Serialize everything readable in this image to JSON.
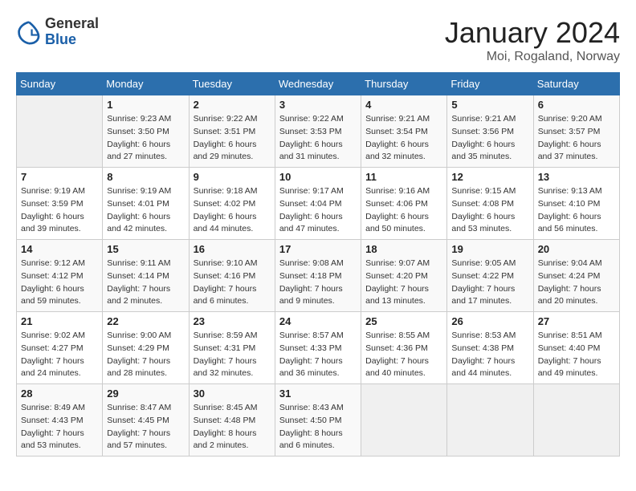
{
  "header": {
    "logo_line1": "General",
    "logo_line2": "Blue",
    "title": "January 2024",
    "subtitle": "Moi, Rogaland, Norway"
  },
  "days_of_week": [
    "Sunday",
    "Monday",
    "Tuesday",
    "Wednesday",
    "Thursday",
    "Friday",
    "Saturday"
  ],
  "weeks": [
    [
      {
        "day": "",
        "info": ""
      },
      {
        "day": "1",
        "info": "Sunrise: 9:23 AM\nSunset: 3:50 PM\nDaylight: 6 hours\nand 27 minutes."
      },
      {
        "day": "2",
        "info": "Sunrise: 9:22 AM\nSunset: 3:51 PM\nDaylight: 6 hours\nand 29 minutes."
      },
      {
        "day": "3",
        "info": "Sunrise: 9:22 AM\nSunset: 3:53 PM\nDaylight: 6 hours\nand 31 minutes."
      },
      {
        "day": "4",
        "info": "Sunrise: 9:21 AM\nSunset: 3:54 PM\nDaylight: 6 hours\nand 32 minutes."
      },
      {
        "day": "5",
        "info": "Sunrise: 9:21 AM\nSunset: 3:56 PM\nDaylight: 6 hours\nand 35 minutes."
      },
      {
        "day": "6",
        "info": "Sunrise: 9:20 AM\nSunset: 3:57 PM\nDaylight: 6 hours\nand 37 minutes."
      }
    ],
    [
      {
        "day": "7",
        "info": "Sunrise: 9:19 AM\nSunset: 3:59 PM\nDaylight: 6 hours\nand 39 minutes."
      },
      {
        "day": "8",
        "info": "Sunrise: 9:19 AM\nSunset: 4:01 PM\nDaylight: 6 hours\nand 42 minutes."
      },
      {
        "day": "9",
        "info": "Sunrise: 9:18 AM\nSunset: 4:02 PM\nDaylight: 6 hours\nand 44 minutes."
      },
      {
        "day": "10",
        "info": "Sunrise: 9:17 AM\nSunset: 4:04 PM\nDaylight: 6 hours\nand 47 minutes."
      },
      {
        "day": "11",
        "info": "Sunrise: 9:16 AM\nSunset: 4:06 PM\nDaylight: 6 hours\nand 50 minutes."
      },
      {
        "day": "12",
        "info": "Sunrise: 9:15 AM\nSunset: 4:08 PM\nDaylight: 6 hours\nand 53 minutes."
      },
      {
        "day": "13",
        "info": "Sunrise: 9:13 AM\nSunset: 4:10 PM\nDaylight: 6 hours\nand 56 minutes."
      }
    ],
    [
      {
        "day": "14",
        "info": "Sunrise: 9:12 AM\nSunset: 4:12 PM\nDaylight: 6 hours\nand 59 minutes."
      },
      {
        "day": "15",
        "info": "Sunrise: 9:11 AM\nSunset: 4:14 PM\nDaylight: 7 hours\nand 2 minutes."
      },
      {
        "day": "16",
        "info": "Sunrise: 9:10 AM\nSunset: 4:16 PM\nDaylight: 7 hours\nand 6 minutes."
      },
      {
        "day": "17",
        "info": "Sunrise: 9:08 AM\nSunset: 4:18 PM\nDaylight: 7 hours\nand 9 minutes."
      },
      {
        "day": "18",
        "info": "Sunrise: 9:07 AM\nSunset: 4:20 PM\nDaylight: 7 hours\nand 13 minutes."
      },
      {
        "day": "19",
        "info": "Sunrise: 9:05 AM\nSunset: 4:22 PM\nDaylight: 7 hours\nand 17 minutes."
      },
      {
        "day": "20",
        "info": "Sunrise: 9:04 AM\nSunset: 4:24 PM\nDaylight: 7 hours\nand 20 minutes."
      }
    ],
    [
      {
        "day": "21",
        "info": "Sunrise: 9:02 AM\nSunset: 4:27 PM\nDaylight: 7 hours\nand 24 minutes."
      },
      {
        "day": "22",
        "info": "Sunrise: 9:00 AM\nSunset: 4:29 PM\nDaylight: 7 hours\nand 28 minutes."
      },
      {
        "day": "23",
        "info": "Sunrise: 8:59 AM\nSunset: 4:31 PM\nDaylight: 7 hours\nand 32 minutes."
      },
      {
        "day": "24",
        "info": "Sunrise: 8:57 AM\nSunset: 4:33 PM\nDaylight: 7 hours\nand 36 minutes."
      },
      {
        "day": "25",
        "info": "Sunrise: 8:55 AM\nSunset: 4:36 PM\nDaylight: 7 hours\nand 40 minutes."
      },
      {
        "day": "26",
        "info": "Sunrise: 8:53 AM\nSunset: 4:38 PM\nDaylight: 7 hours\nand 44 minutes."
      },
      {
        "day": "27",
        "info": "Sunrise: 8:51 AM\nSunset: 4:40 PM\nDaylight: 7 hours\nand 49 minutes."
      }
    ],
    [
      {
        "day": "28",
        "info": "Sunrise: 8:49 AM\nSunset: 4:43 PM\nDaylight: 7 hours\nand 53 minutes."
      },
      {
        "day": "29",
        "info": "Sunrise: 8:47 AM\nSunset: 4:45 PM\nDaylight: 7 hours\nand 57 minutes."
      },
      {
        "day": "30",
        "info": "Sunrise: 8:45 AM\nSunset: 4:48 PM\nDaylight: 8 hours\nand 2 minutes."
      },
      {
        "day": "31",
        "info": "Sunrise: 8:43 AM\nSunset: 4:50 PM\nDaylight: 8 hours\nand 6 minutes."
      },
      {
        "day": "",
        "info": ""
      },
      {
        "day": "",
        "info": ""
      },
      {
        "day": "",
        "info": ""
      }
    ]
  ]
}
